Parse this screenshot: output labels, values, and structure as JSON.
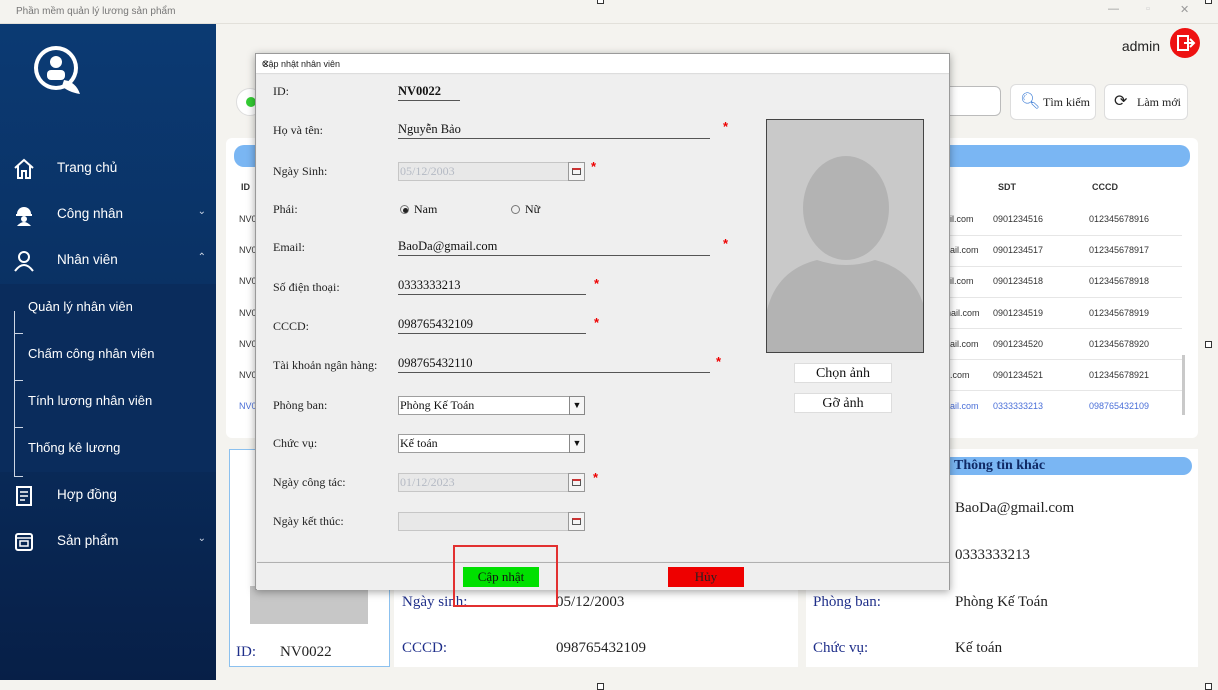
{
  "app": {
    "title": "Phần mềm quản lý lương sản phẩm",
    "user": "admin"
  },
  "sidebar": {
    "items": [
      {
        "label": "Trang chủ"
      },
      {
        "label": "Công nhân"
      },
      {
        "label": "Nhân viên"
      },
      {
        "label": "Quản lý nhân viên"
      },
      {
        "label": "Chấm công nhân viên"
      },
      {
        "label": "Tính lương nhân viên"
      },
      {
        "label": "Thống kê lương"
      },
      {
        "label": "Hợp đồng"
      },
      {
        "label": "Sản phẩm"
      }
    ]
  },
  "toolbar": {
    "search_label": "Tìm kiếm",
    "refresh_label": "Làm mới"
  },
  "table": {
    "headers": [
      "ID",
      "SDT",
      "CCCD"
    ],
    "rows": [
      {
        "id": "NV0",
        "email": "il.com",
        "phone": "0901234516",
        "cccd": "012345678916"
      },
      {
        "id": "NV0",
        "email": "ail.com",
        "phone": "0901234517",
        "cccd": "012345678917"
      },
      {
        "id": "NV0",
        "email": "il.com",
        "phone": "0901234518",
        "cccd": "012345678918"
      },
      {
        "id": "NV0",
        "email": "nail.com",
        "phone": "0901234519",
        "cccd": "012345678919"
      },
      {
        "id": "NV0",
        "email": "ail.com",
        "phone": "0901234520",
        "cccd": "012345678920"
      },
      {
        "id": "NV0",
        "email": ".com",
        "phone": "0901234521",
        "cccd": "012345678921"
      },
      {
        "id": "NV0",
        "email": "ail.com",
        "phone": "0333333213",
        "cccd": "098765432109"
      }
    ]
  },
  "details": {
    "id_label": "ID:",
    "id_value": "NV0022",
    "birth_label": "Ngày sinh:",
    "birth_value": "05/12/2003",
    "cccd_label": "CCCD:",
    "cccd_value": "098765432109",
    "other_title": "Thông tin khác",
    "email_value": "BaoDa@gmail.com",
    "phone_value": "0333333213",
    "dept_label": "Phòng ban:",
    "dept_value": "Phòng Kế Toán",
    "position_label": "Chức vụ:",
    "position_value": "Kế toán"
  },
  "dialog": {
    "title": "Cập nhật nhân viên",
    "labels": {
      "id": "ID:",
      "name": "Họ và tên:",
      "birth": "Ngày Sinh:",
      "gender": "Phái:",
      "email": "Email:",
      "phone": "Số điện thoại:",
      "cccd": "CCCD:",
      "bank": "Tài khoản ngân hàng:",
      "dept": "Phòng ban:",
      "position": "Chức vụ:",
      "start": "Ngày công tác:",
      "end": "Ngày kết thúc:"
    },
    "values": {
      "id": "NV0022",
      "name": "Nguyễn Bảo",
      "birth": "05/12/2003",
      "email": "BaoDa@gmail.com",
      "phone": "0333333213",
      "cccd": "098765432109",
      "bank": "098765432110",
      "dept": "Phòng Kế Toán",
      "position": "Kế toán",
      "start": "01/12/2023",
      "end": ""
    },
    "gender_options": [
      "Nam",
      "Nữ"
    ],
    "gender_selected": "Nam",
    "required_mark": "*",
    "choose_photo": "Chọn ảnh",
    "remove_photo": "Gỡ ảnh",
    "update_button": "Cập nhật",
    "cancel_button": "Hủy"
  },
  "colors": {
    "sidebar": "#0b3a73",
    "accent": "#7ab6f3",
    "update": "#00e000",
    "cancel": "#ee0000",
    "highlight": "#e23030"
  }
}
